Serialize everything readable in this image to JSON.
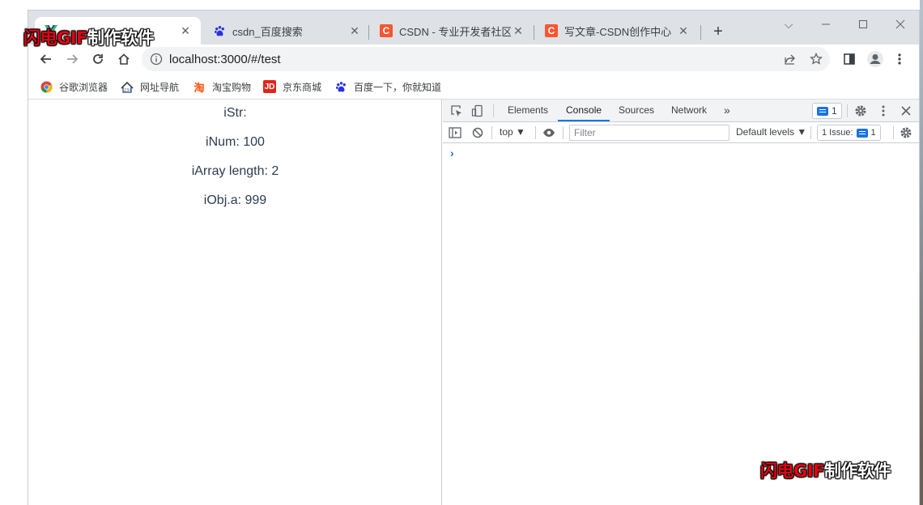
{
  "window": {
    "tabs": [
      {
        "title": "",
        "active": true,
        "icon": "vue-icon"
      },
      {
        "title": "csdn_百度搜索",
        "active": false,
        "icon": "baidu-paw-icon"
      },
      {
        "title": "CSDN - 专业开发者社区",
        "active": false,
        "icon": "csdn-icon"
      },
      {
        "title": "写文章-CSDN创作中心",
        "active": false,
        "icon": "csdn-icon"
      }
    ],
    "favicon_letter": "C",
    "new_tab": "+",
    "controls": {
      "minimize": "—",
      "maximize": "☐",
      "close": "✕",
      "tab_search": "⌵"
    }
  },
  "toolbar": {
    "url": "localhost:3000/#/test"
  },
  "bookmarks": [
    {
      "label": "谷歌浏览器",
      "icon": "chrome-icon"
    },
    {
      "label": "网址导航",
      "icon": "hao123-icon"
    },
    {
      "label": "淘宝购物",
      "icon": "taobao-icon",
      "glyph": "淘"
    },
    {
      "label": "京东商城",
      "icon": "jd-icon",
      "glyph": "JD"
    },
    {
      "label": "百度一下，你就知道",
      "icon": "baidu-paw-icon"
    }
  ],
  "page": {
    "lines": [
      "iStr:",
      "iNum: 100",
      "iArray length: 2",
      "iObj.a: 999"
    ]
  },
  "devtools": {
    "tabs": [
      "Elements",
      "Console",
      "Sources",
      "Network"
    ],
    "active_tab": "Console",
    "more": "»",
    "issues_count": "1",
    "context": "top ▼",
    "filter_placeholder": "Filter",
    "levels": "Default levels ▼",
    "issues_label": "1 Issue:",
    "issues_small_count": "1",
    "prompt": "›"
  },
  "watermark": {
    "red": "闪电GIF",
    "white": "制作软件"
  },
  "colors": {
    "accent": "#1a73e8",
    "csdn": "#fc5531",
    "jd": "#e1251b"
  }
}
